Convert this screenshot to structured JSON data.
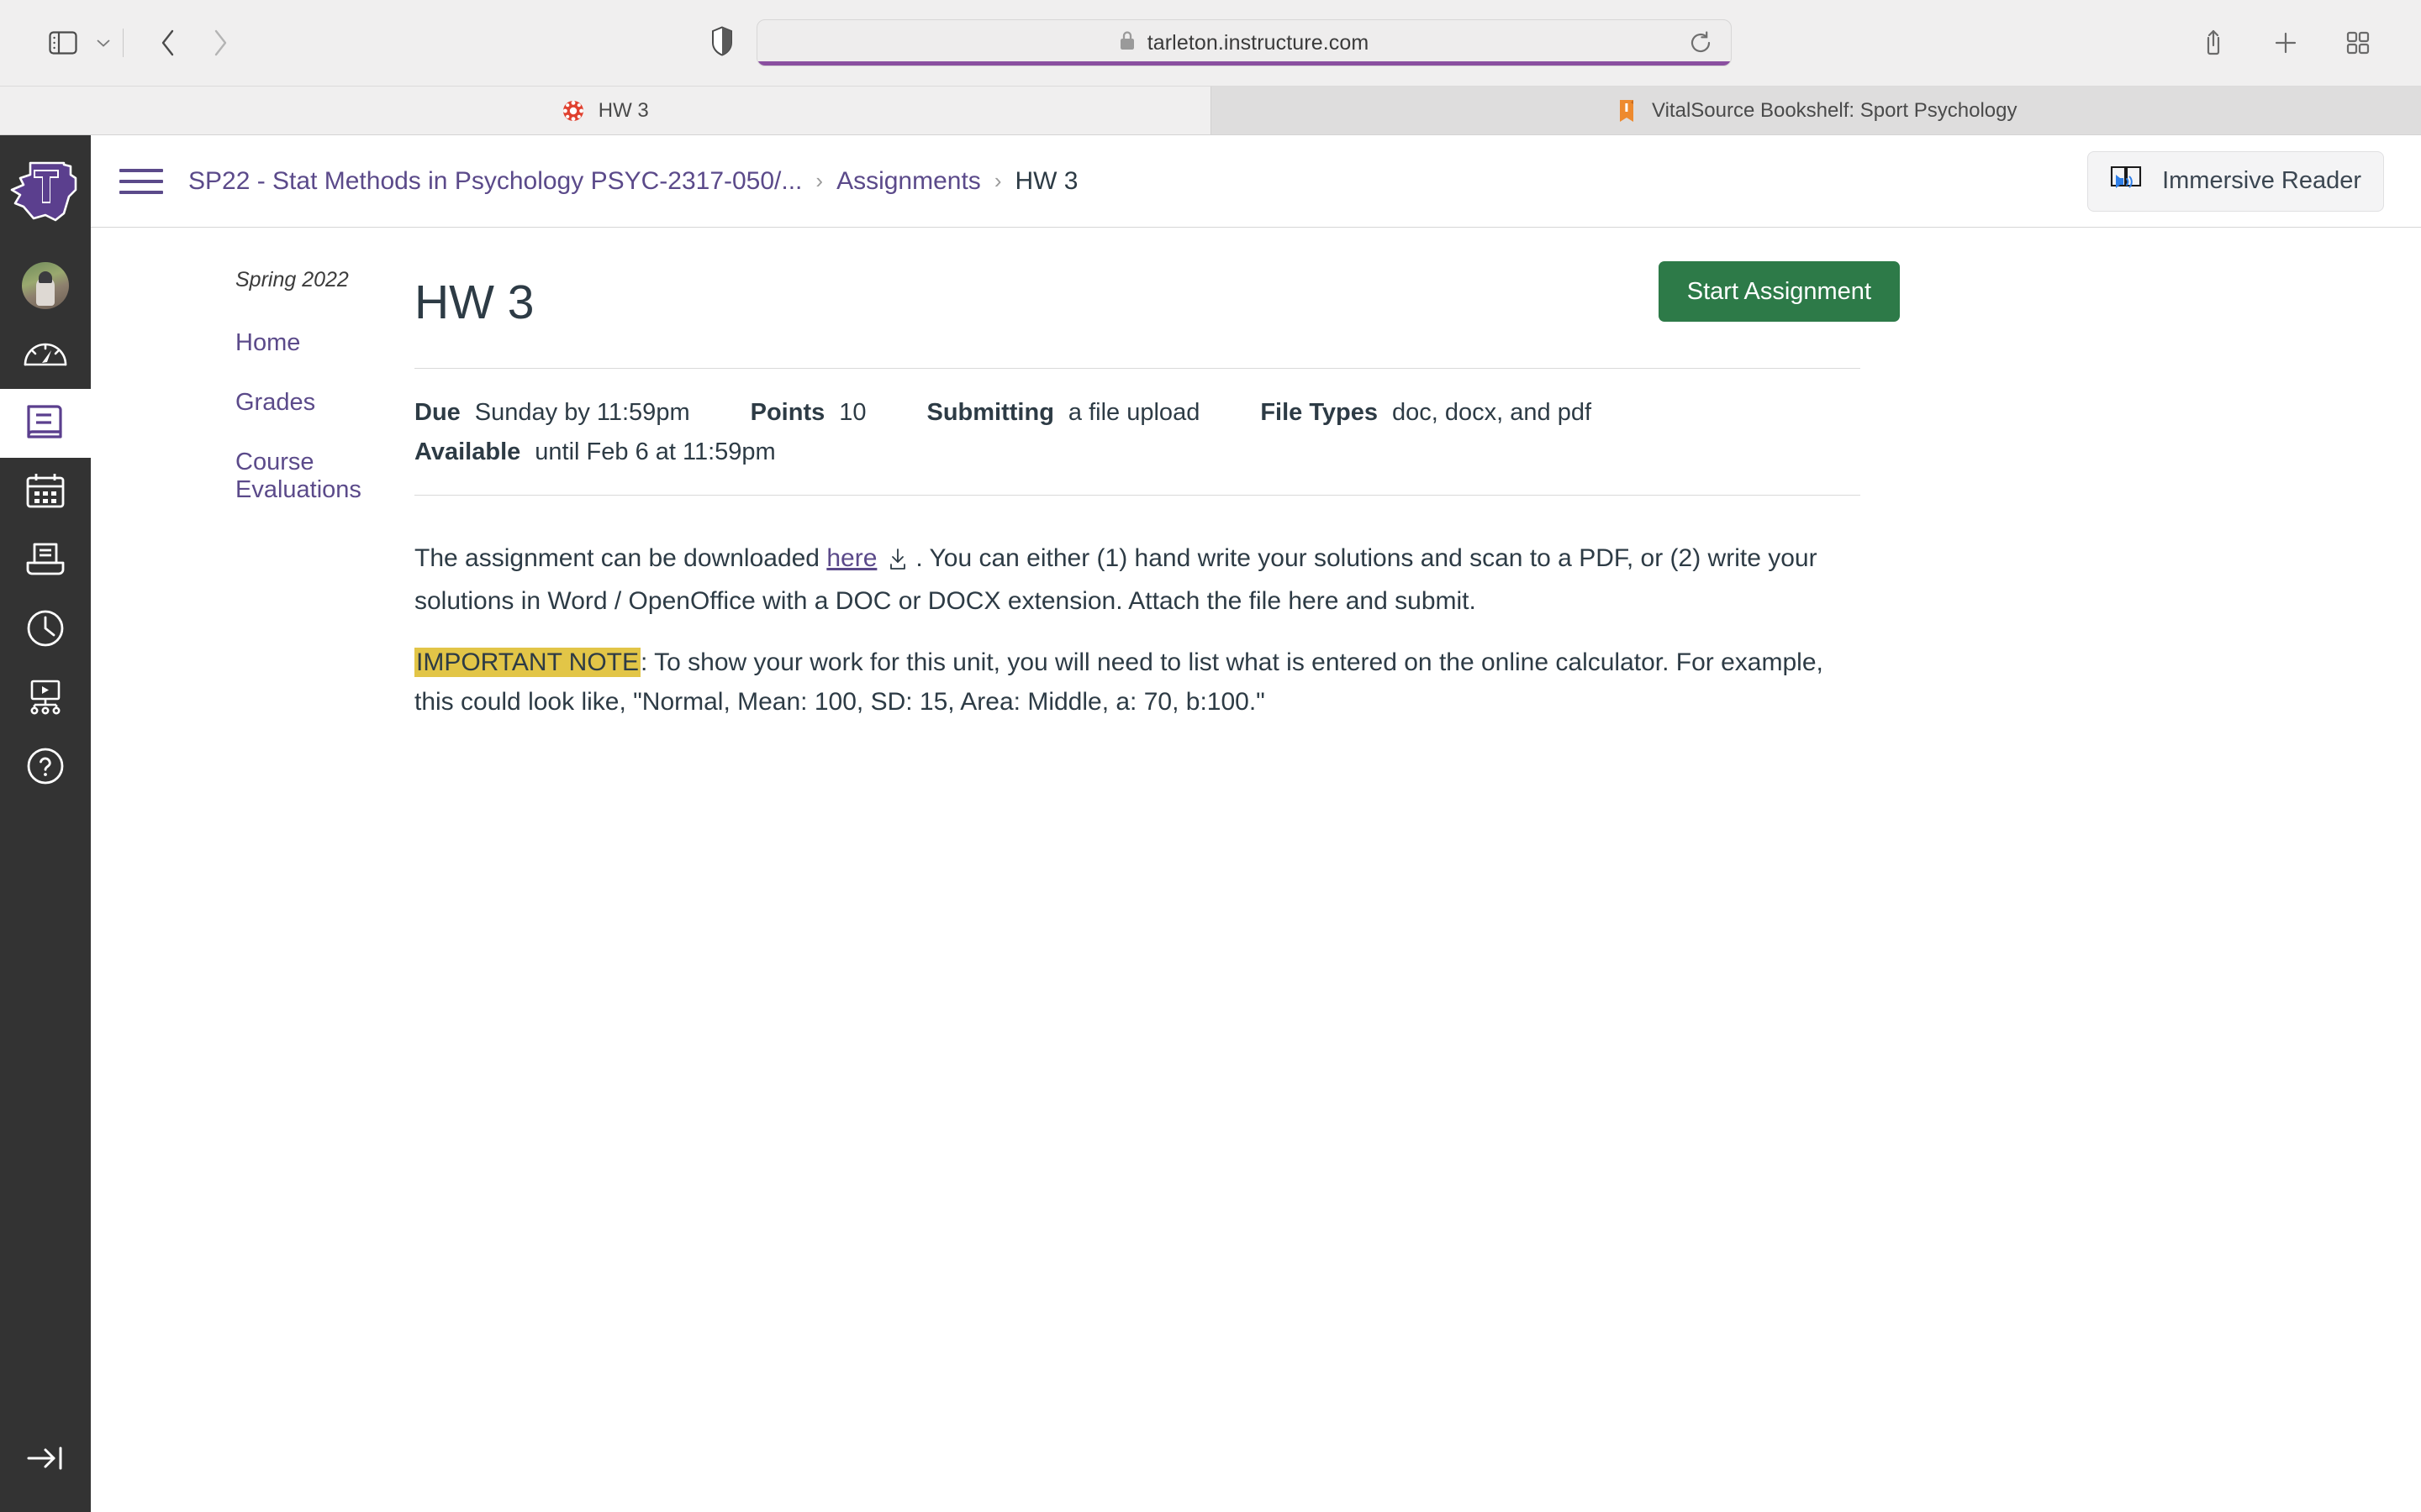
{
  "browser": {
    "url": "tarleton.instructure.com",
    "lock_icon": "lock-icon",
    "sidebar_toggle_icon": "sidebar-toggle-icon",
    "sidebar_chevron_icon": "chevron-down-icon",
    "back_icon": "chevron-left-icon",
    "forward_icon": "chevron-right-icon",
    "shield_icon": "shield-icon",
    "reload_icon": "reload-icon",
    "share_icon": "share-icon",
    "new_tab_icon": "plus-icon",
    "tab_overview_icon": "grid-icon",
    "tabs": [
      {
        "title": "HW 3",
        "favicon": "canvas-logo-icon",
        "active": true
      },
      {
        "title": "VitalSource Bookshelf: Sport Psychology",
        "favicon": "bookshelf-icon",
        "active": false
      }
    ]
  },
  "global_nav": {
    "logo": "tarleton-texas-t-logo",
    "items": [
      {
        "name": "account",
        "icon": "avatar-icon",
        "active": false
      },
      {
        "name": "dashboard",
        "icon": "speedometer-icon",
        "active": false
      },
      {
        "name": "courses",
        "icon": "book-icon",
        "active": true
      },
      {
        "name": "calendar",
        "icon": "calendar-icon",
        "active": false
      },
      {
        "name": "inbox",
        "icon": "inbox-tray-icon",
        "active": false
      },
      {
        "name": "history",
        "icon": "clock-icon",
        "active": false
      },
      {
        "name": "studio",
        "icon": "studio-screen-icon",
        "active": false
      },
      {
        "name": "help",
        "icon": "question-circle-icon",
        "active": false
      }
    ],
    "expand_icon": "arrow-to-line-right-icon"
  },
  "header": {
    "menu_icon": "hamburger-menu-icon",
    "breadcrumb": [
      {
        "label": "SP22 - Stat Methods in Psychology PSYC-2317-050/...",
        "current": false
      },
      {
        "label": "Assignments",
        "current": false
      },
      {
        "label": "HW 3",
        "current": true
      }
    ],
    "separator": "›",
    "immersive_reader": {
      "label": "Immersive Reader",
      "icon": "immersive-reader-icon"
    }
  },
  "course_nav": {
    "term": "Spring 2022",
    "items": [
      {
        "label": "Home"
      },
      {
        "label": "Grades"
      },
      {
        "label": "Course Evaluations"
      }
    ]
  },
  "assignment": {
    "title": "HW 3",
    "start_button": "Start Assignment",
    "meta": [
      {
        "label": "Due",
        "value": "Sunday by 11:59pm"
      },
      {
        "label": "Points",
        "value": "10"
      },
      {
        "label": "Submitting",
        "value": "a file upload"
      },
      {
        "label": "File Types",
        "value": "doc, docx, and pdf"
      }
    ],
    "meta_second_row": [
      {
        "label": "Available",
        "value": "until Feb 6 at 11:59pm"
      }
    ],
    "description": {
      "p1_before_link": "The assignment can be downloaded ",
      "p1_link": "here",
      "p1_download_icon": "download-icon",
      "p1_after_link": ".  You can either (1) hand write your solutions and scan to a PDF, or (2) write your solutions in Word / OpenOffice with a DOC or DOCX extension.  Attach the file here and submit.",
      "p2_highlight": "IMPORTANT NOTE",
      "p2_rest": ": To show your work for this unit, you will need to list what is entered on the online calculator. For example, this could look like, \"Normal, Mean: 100, SD: 15, Area: Middle, a: 70, b:100.\""
    }
  },
  "colors": {
    "canvas_purple": "#5b4a8a",
    "start_button_green": "#2d7a48",
    "highlight_yellow": "#e2c547",
    "global_nav_dark": "#333333",
    "url_progress": "#8a4fa0"
  }
}
